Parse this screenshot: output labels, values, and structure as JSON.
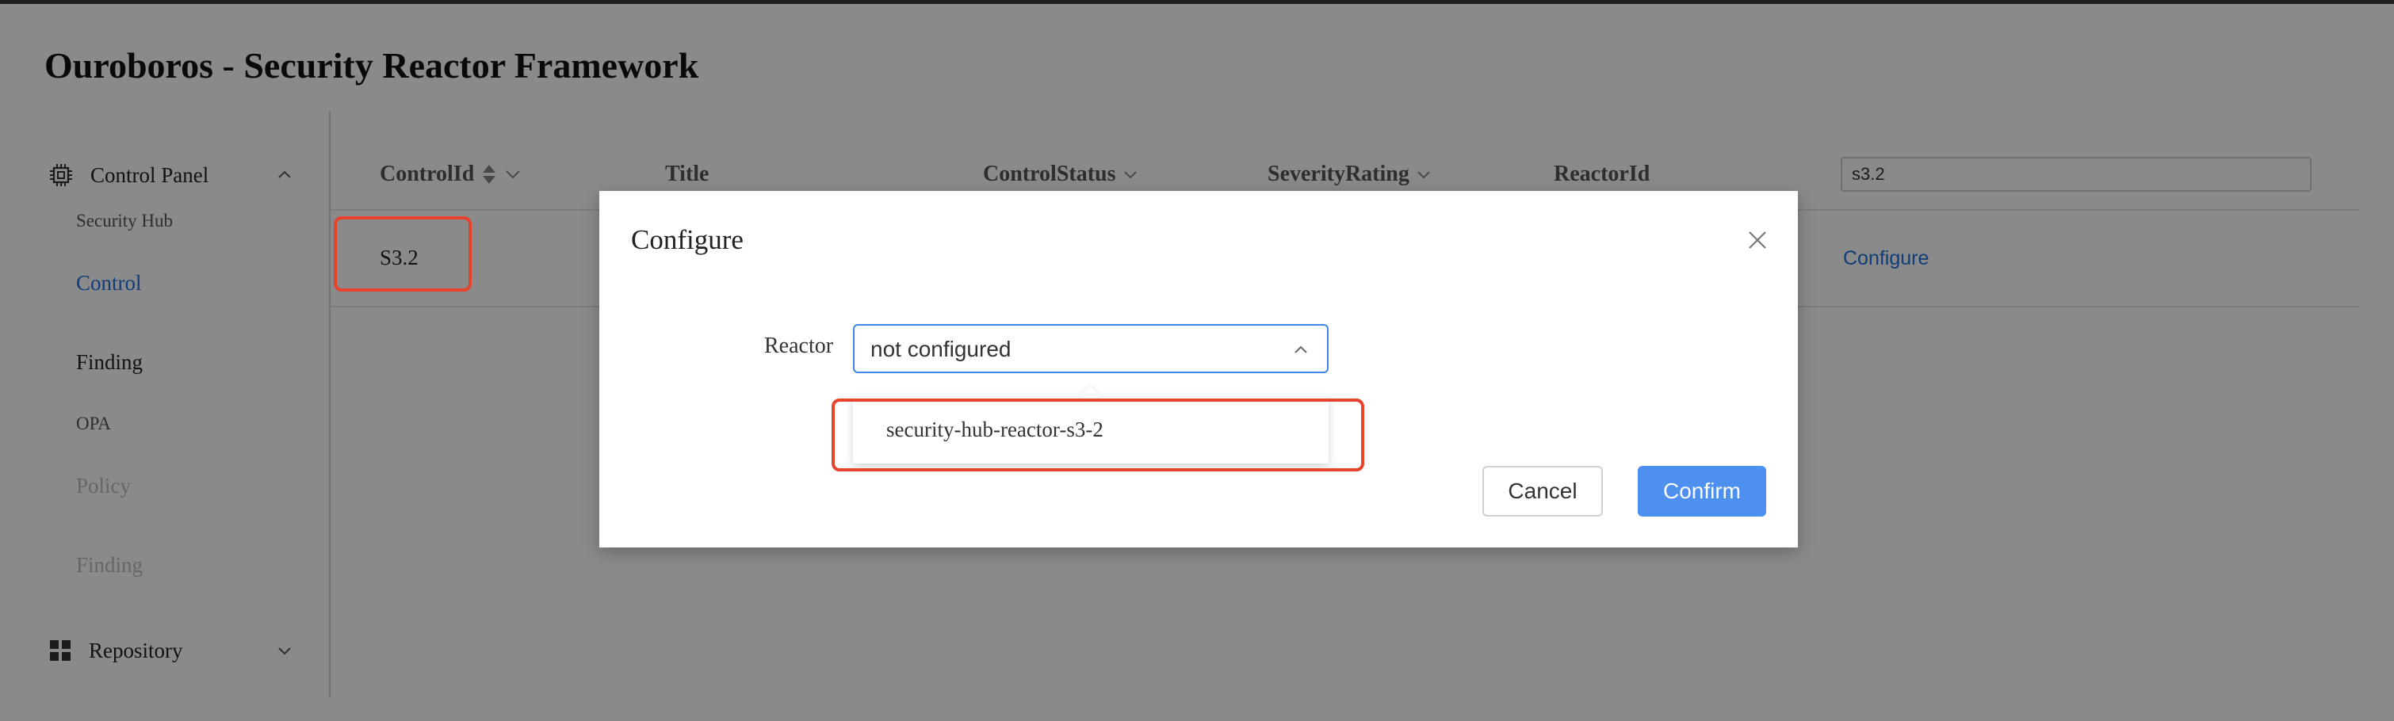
{
  "app": {
    "title": "Ouroboros - Security Reactor Framework"
  },
  "sidebar": {
    "groups": [
      {
        "label": "Control Panel",
        "icon": "chip-icon",
        "state": "expanded"
      },
      {
        "label": "Repository",
        "icon": "grid-icon",
        "state": "collapsed"
      }
    ],
    "items": [
      {
        "label": "Security Hub"
      },
      {
        "label": "Control",
        "active": true
      },
      {
        "label": "Finding"
      },
      {
        "label": "OPA"
      },
      {
        "label": "Policy",
        "disabled": true
      },
      {
        "label": "Finding",
        "disabled": true
      }
    ]
  },
  "table": {
    "headers": [
      "ControlId",
      "Title",
      "ControlStatus",
      "SeverityRating",
      "ReactorId"
    ],
    "filter_value": "s3.2",
    "rows": [
      {
        "control_id": "S3.2",
        "action": "Configure"
      }
    ]
  },
  "modal": {
    "title": "Configure",
    "field_label": "Reactor",
    "select_value": "not configured",
    "options": [
      "security-hub-reactor-s3-2"
    ],
    "cancel_label": "Cancel",
    "confirm_label": "Confirm"
  },
  "colors": {
    "accent": "#1f6fe0",
    "primary_button": "#4e90ef",
    "highlight": "#e8412c"
  }
}
